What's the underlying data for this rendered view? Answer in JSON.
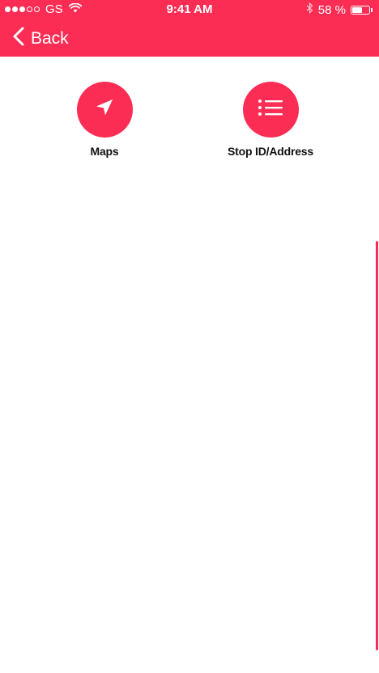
{
  "theme": {
    "accent": "#fc2d55",
    "background": "#ffffff"
  },
  "status_bar": {
    "signal_bars_filled": 3,
    "signal_bars_total": 5,
    "carrier": "GS",
    "time": "9:41 AM",
    "battery_percent_label": "58 %",
    "battery_level": 0.58,
    "icons": [
      "wifi-icon",
      "bluetooth-icon",
      "battery-icon"
    ]
  },
  "nav": {
    "back_label": "Back",
    "back_icon": "chevron-left-icon"
  },
  "actions": [
    {
      "label": "Maps",
      "icon": "navigation-arrow-icon"
    },
    {
      "label": "Stop ID/Address",
      "icon": "list-icon"
    }
  ]
}
